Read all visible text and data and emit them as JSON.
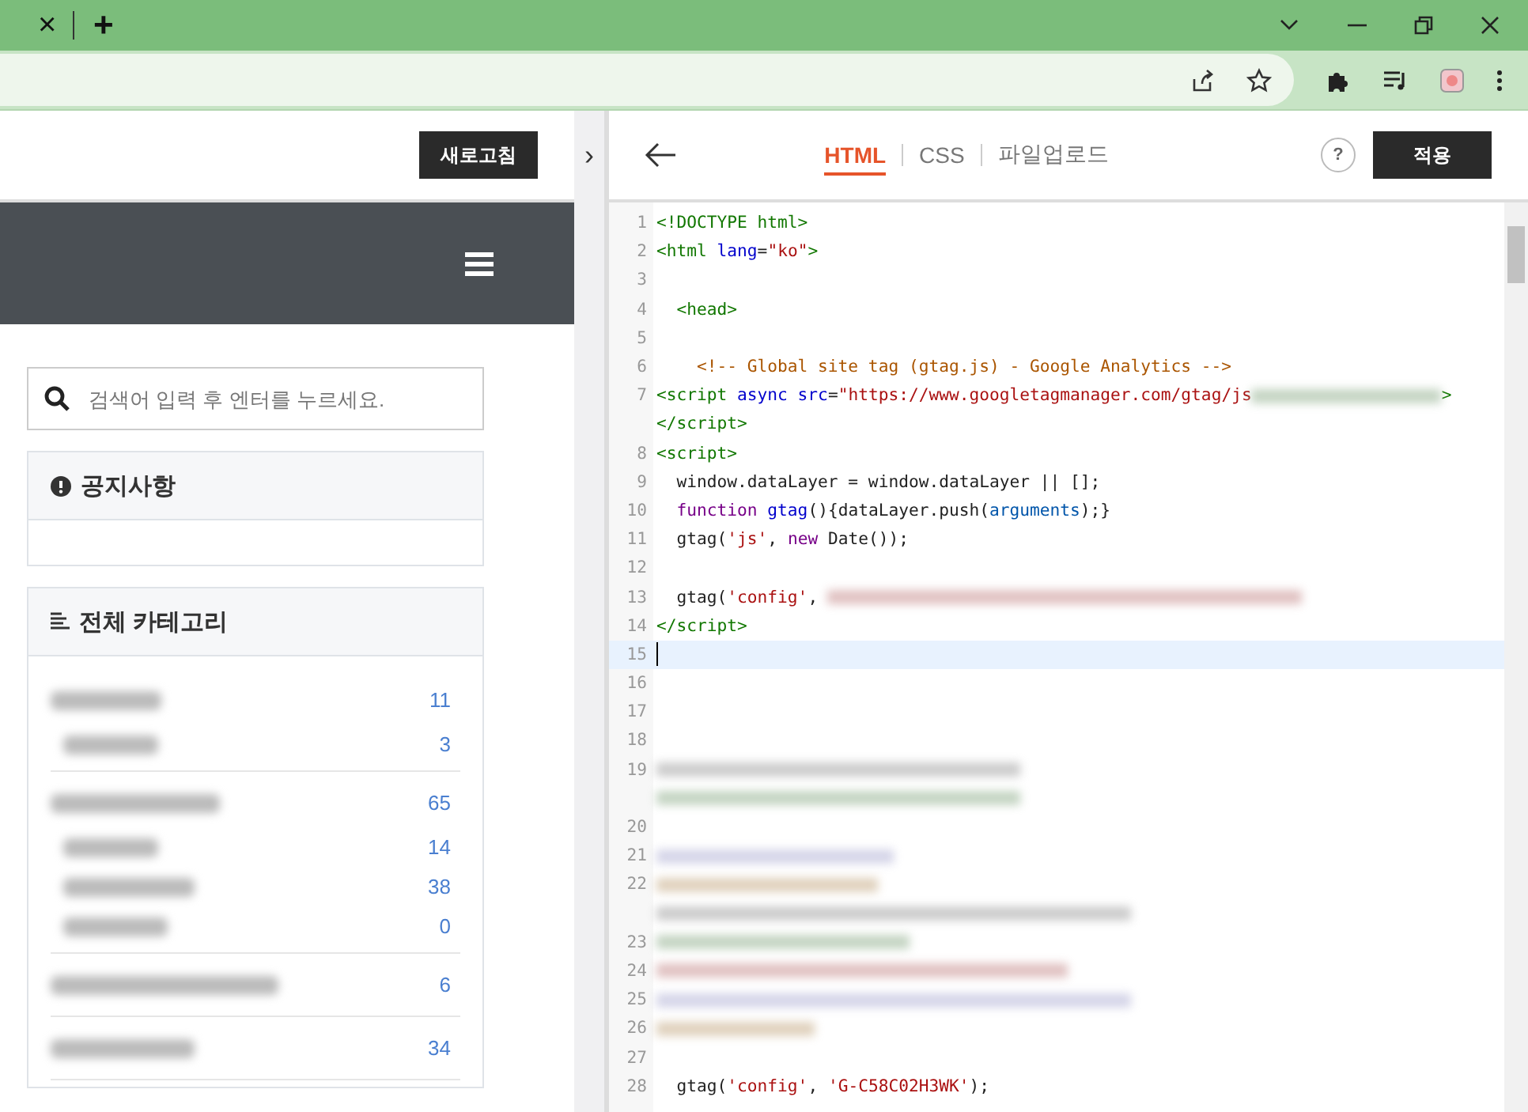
{
  "browser": {
    "tab_close": "×",
    "new_tab": "+"
  },
  "left_toolbar": {
    "refresh_button": "새로고침",
    "toggle": "›"
  },
  "sidebar": {
    "search": {
      "placeholder": "검색어 입력 후 엔터를 누르세요."
    },
    "notice": {
      "title": "공지사항"
    },
    "categories": {
      "title": "전체 카테고리",
      "items": [
        {
          "count": "11",
          "children": [
            {
              "count": "3"
            }
          ]
        },
        {
          "count": "65",
          "children": [
            {
              "count": "14"
            },
            {
              "count": "38"
            },
            {
              "count": "0"
            }
          ]
        },
        {
          "count": "6"
        },
        {
          "count": "34"
        }
      ]
    }
  },
  "editor": {
    "tabs": [
      {
        "label": "HTML",
        "selected": true
      },
      {
        "label": "CSS",
        "selected": false
      },
      {
        "label": "파일업로드",
        "selected": false
      }
    ],
    "help": "?",
    "apply_button": "적용",
    "lines": [
      {
        "num": "1",
        "tokens": [
          {
            "kind": "tag",
            "text": "<!DOCTYPE html>"
          }
        ]
      },
      {
        "num": "2",
        "tokens": [
          {
            "kind": "tag",
            "text": "<html "
          },
          {
            "kind": "attr",
            "text": "lang"
          },
          {
            "kind": "plain",
            "text": "="
          },
          {
            "kind": "string",
            "text": "\"ko\""
          },
          {
            "kind": "tag",
            "text": ">"
          }
        ]
      },
      {
        "num": "3"
      },
      {
        "num": "4",
        "tokens": [
          {
            "kind": "tag",
            "text": "  <head>"
          }
        ]
      },
      {
        "num": "5"
      },
      {
        "num": "6",
        "tokens": [
          {
            "kind": "comment",
            "text": "    <!-- Global site tag (gtag.js) - Google Analytics -->"
          }
        ]
      },
      {
        "num": "7",
        "tokens": [
          {
            "kind": "tag",
            "text": "<script "
          },
          {
            "kind": "attr",
            "text": "async src"
          },
          {
            "kind": "plain",
            "text": "="
          },
          {
            "kind": "string",
            "text": "\"https://www.googletagmanager.com/gtag/js"
          },
          {
            "kind": "redacted"
          },
          {
            "kind": "tag",
            "text": ">"
          }
        ]
      },
      {
        "tokens": [
          {
            "kind": "tag",
            "text": "</script>"
          }
        ]
      },
      {
        "num": "8",
        "tokens": [
          {
            "kind": "tag",
            "text": "<script>"
          }
        ]
      },
      {
        "num": "9",
        "tokens": [
          {
            "kind": "plain",
            "text": "  window.dataLayer = window.dataLayer || [];"
          }
        ]
      },
      {
        "num": "10",
        "tokens": [
          {
            "kind": "keyword",
            "text": "  function "
          },
          {
            "kind": "attr",
            "text": "gtag"
          },
          {
            "kind": "plain",
            "text": "(){dataLayer.push("
          },
          {
            "kind": "var",
            "text": "arguments"
          },
          {
            "kind": "plain",
            "text": ");}"
          }
        ]
      },
      {
        "num": "11",
        "tokens": [
          {
            "kind": "plain",
            "text": "  gtag("
          },
          {
            "kind": "string",
            "text": "'js'"
          },
          {
            "kind": "plain",
            "text": ", "
          },
          {
            "kind": "keyword",
            "text": "new"
          },
          {
            "kind": "plain",
            "text": " Date());"
          }
        ]
      },
      {
        "num": "12"
      },
      {
        "num": "13",
        "tokens": [
          {
            "kind": "plain",
            "text": "  gtag("
          },
          {
            "kind": "string",
            "text": "'config'"
          },
          {
            "kind": "plain",
            "text": ", "
          },
          {
            "kind": "redacted"
          }
        ]
      },
      {
        "num": "14",
        "tokens": [
          {
            "kind": "tag",
            "text": "</script>"
          }
        ]
      },
      {
        "num": "15",
        "current": true
      },
      {
        "num": "16"
      },
      {
        "num": "17"
      },
      {
        "num": "18"
      },
      {
        "num": "19",
        "tokens": [
          {
            "kind": "redacted"
          }
        ]
      },
      {
        "tokens": [
          {
            "kind": "redacted"
          }
        ]
      },
      {
        "num": "20"
      },
      {
        "num": "21",
        "tokens": [
          {
            "kind": "redacted"
          }
        ]
      },
      {
        "num": "22",
        "tokens": [
          {
            "kind": "redacted"
          }
        ]
      },
      {
        "tokens": [
          {
            "kind": "redacted"
          }
        ]
      },
      {
        "num": "23",
        "tokens": [
          {
            "kind": "redacted"
          }
        ]
      },
      {
        "num": "24",
        "tokens": [
          {
            "kind": "redacted"
          }
        ]
      },
      {
        "num": "25",
        "tokens": [
          {
            "kind": "redacted"
          }
        ]
      },
      {
        "num": "26",
        "tokens": [
          {
            "kind": "redacted"
          }
        ]
      },
      {
        "num": "27"
      },
      {
        "num": "28",
        "tokens": [
          {
            "kind": "plain",
            "text": "  gtag("
          },
          {
            "kind": "string",
            "text": "'config'"
          },
          {
            "kind": "plain",
            "text": ", "
          },
          {
            "kind": "string",
            "text": "'G-C58C02H3WK'"
          },
          {
            "kind": "plain",
            "text": ");"
          }
        ]
      }
    ]
  }
}
